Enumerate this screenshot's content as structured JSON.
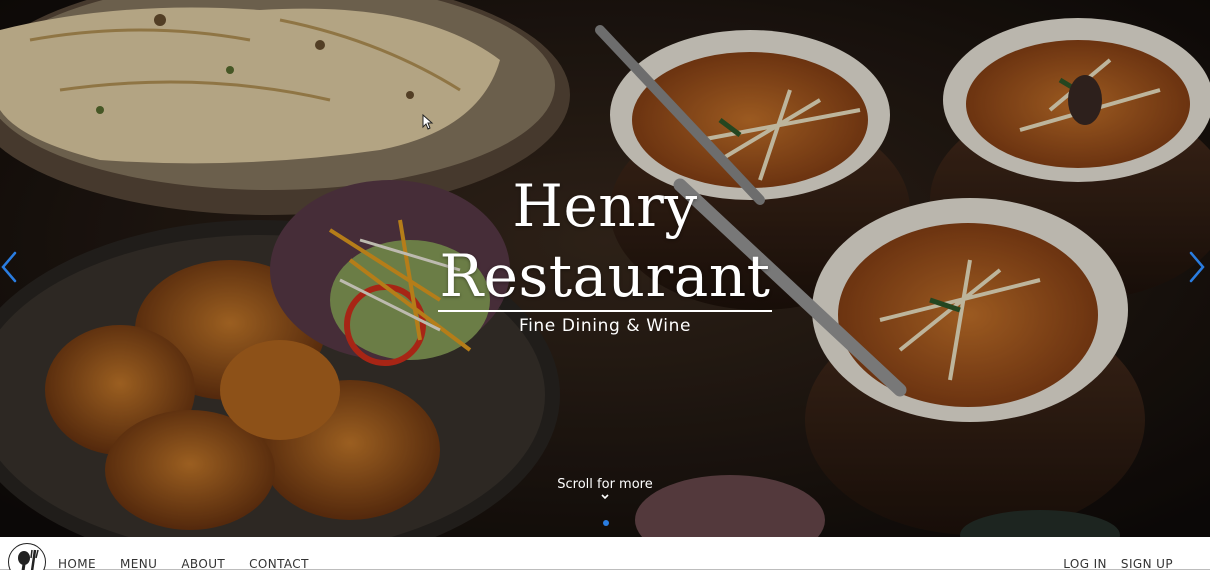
{
  "hero": {
    "title_line1": "Henry",
    "title_line2": "Restaurant",
    "subtitle": "Fine Dining & Wine",
    "scroll_label": "Scroll for more",
    "prev_icon": "chevron-left-icon",
    "next_icon": "chevron-right-icon",
    "active_slide": 1,
    "slide_count": 1
  },
  "nav": {
    "logo_icon": "spoon-fork-logo-icon",
    "links": [
      "HOME",
      "MENU",
      "ABOUT",
      "CONTACT"
    ],
    "log_in": "LOG IN",
    "sign_up": "SIGN UP"
  },
  "colors": {
    "accent": "#2a7de1",
    "hero_text": "#ffffff",
    "nav_text": "#333333"
  }
}
